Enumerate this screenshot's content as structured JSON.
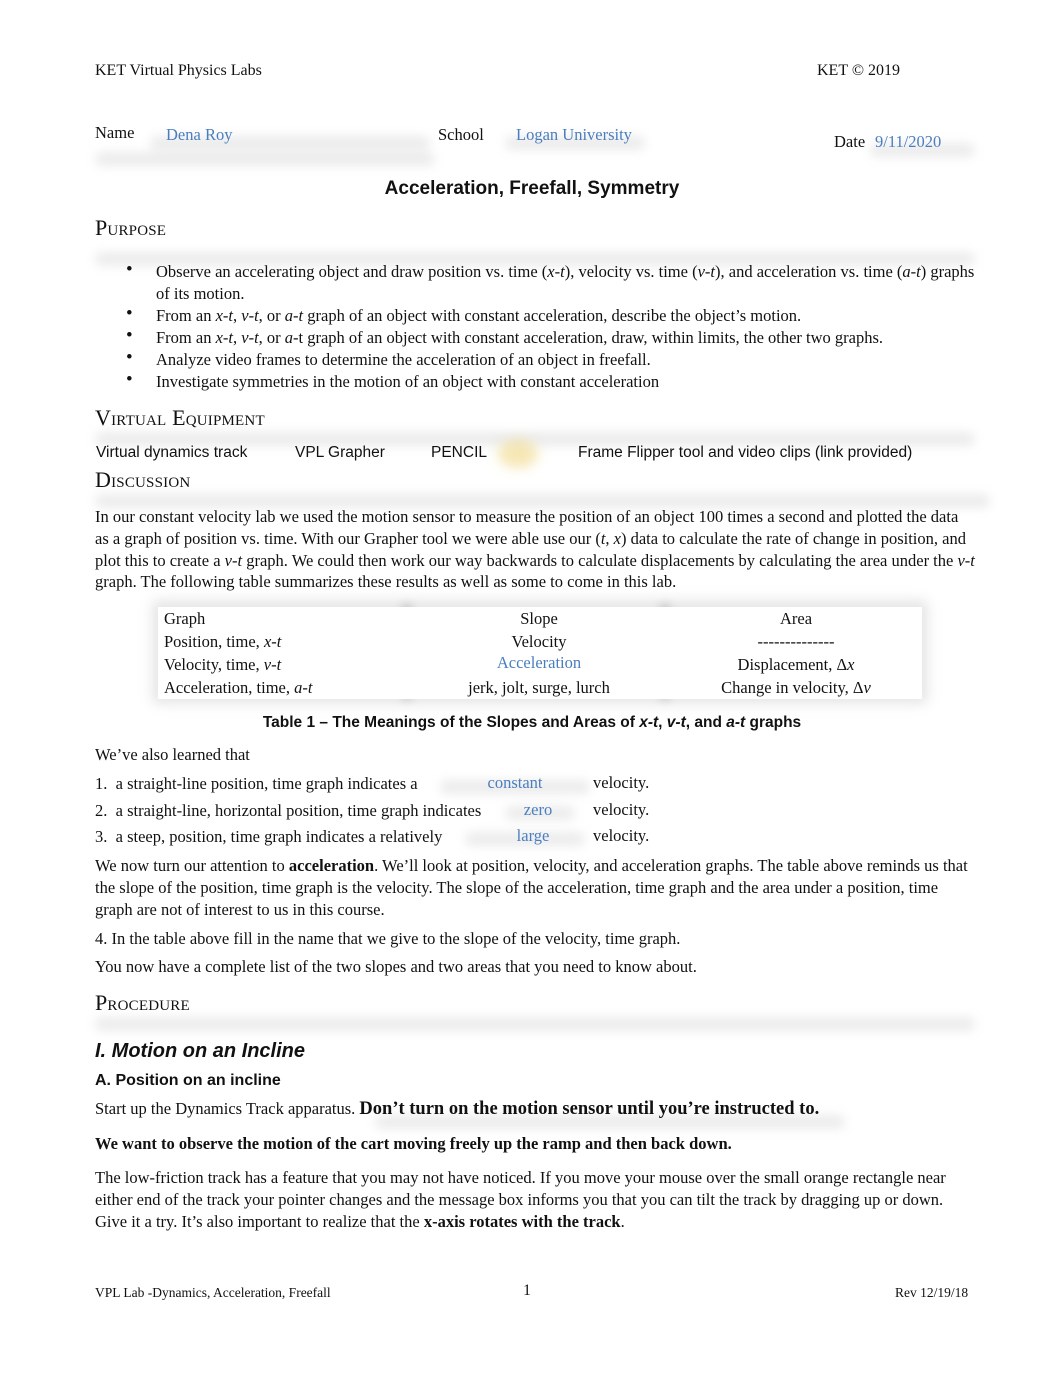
{
  "header": {
    "left": "KET Virtual Physics Labs",
    "right": "KET © 2019"
  },
  "student": {
    "name_label": "Name",
    "name_value": "Dena Roy",
    "school_label": "School",
    "school_value": "Logan University",
    "date_label": "Date",
    "date_value": "9/11/2020"
  },
  "title": "Acceleration, Freefall, Symmetry",
  "purpose": {
    "heading": "Purpose",
    "bullets": [
      "Observe an accelerating object and draw position vs. time (x-t), velocity vs. time (v-t), and acceleration vs. time (a-t) graphs of its motion.",
      "From an x-t, v-t, or a-t graph of an object with constant acceleration, describe the object’s motion.",
      "From an x-t, v-t, or a-t graph of an object with constant acceleration, draw, within limits, the other two graphs.",
      "Analyze video frames to determine the acceleration of an object in freefall.",
      "Investigate symmetries in the motion of an object with constant acceleration"
    ]
  },
  "equipment": {
    "heading": "Virtual Equipment",
    "items": [
      "Virtual dynamics track",
      "VPL Grapher",
      "PENCIL",
      "Frame Flipper tool and video clips (link provided)"
    ]
  },
  "discussion": {
    "heading": "Discussion",
    "intro": "In our constant velocity lab we used the motion sensor to measure the position of an object 100 times a second and plotted the data as a graph of position vs. time. With our Grapher tool we were able use our (t, x) data to calculate the rate of change in position, and plot this to create a v-t graph. We could then work our way backwards to calculate displacements by calculating the area under the v-t graph. The following table summarizes these results as well as some to come in this lab.",
    "table": {
      "headers": [
        "Graph",
        "Slope",
        "Area"
      ],
      "rows": [
        [
          "Position, time, ",
          "x-t",
          "Velocity",
          "--------------"
        ],
        [
          "Velocity, time, ",
          "v-t",
          "Acceleration",
          "Displacement, Δx"
        ],
        [
          "Acceleration, time, ",
          "a-t",
          "jerk, jolt, surge, lurch",
          "Change in velocity, Δv"
        ]
      ],
      "caption": "Table 1 – The Meanings of the Slopes and Areas of x-t, v-t, and a-t graphs"
    },
    "learned_intro": "We’ve also learned that",
    "learned": [
      {
        "num": "1.",
        "text": "a straight-line position, time graph indicates a",
        "answer": "constant",
        "suffix": "velocity."
      },
      {
        "num": "2.",
        "text": "a straight-line, horizontal position, time graph indicates",
        "answer": "zero",
        "suffix": "velocity."
      },
      {
        "num": "3.",
        "text": "a steep, position, time graph indicates a relatively",
        "answer": "large",
        "suffix": "velocity."
      }
    ],
    "accel_para_pre": "We now turn our attention to ",
    "accel_para_bold": "acceleration",
    "accel_para_post": ". We’ll look at position, velocity, and acceleration graphs. The table above reminds us that the slope of the position, time graph is the velocity. The slope of the acceleration, time graph and the area under a position, time graph are not of interest to us in this course.",
    "q4": "4.  In the table above fill in the name that we give to the slope of the velocity, time graph.",
    "summary": "You now have a complete list of the two slopes and two areas that you need to know about."
  },
  "procedure": {
    "heading": "Procedure",
    "section": "I. Motion on an Incline",
    "subsection": "A. Position on an incline",
    "start_pre": "Start up the Dynamics Track apparatus. ",
    "start_bold": "Don’t turn on the motion sensor until you’re instructed to.",
    "observe": "We want to observe the motion of the cart moving freely up the ramp and then back down.",
    "track_pre": "The low-friction track has a feature that you may not have noticed. If you move your mouse over the small orange rectangle near either end of the track your pointer changes and the message box informs you that you can tilt the track by dragging up or down. Give it a try. It’s also important to realize that the ",
    "track_bold": "x-axis rotates with the track",
    "track_post": "."
  },
  "footer": {
    "left": "VPL Lab -Dynamics, Acceleration, Freefall",
    "page": "1",
    "right": "Rev 12/19/18"
  }
}
